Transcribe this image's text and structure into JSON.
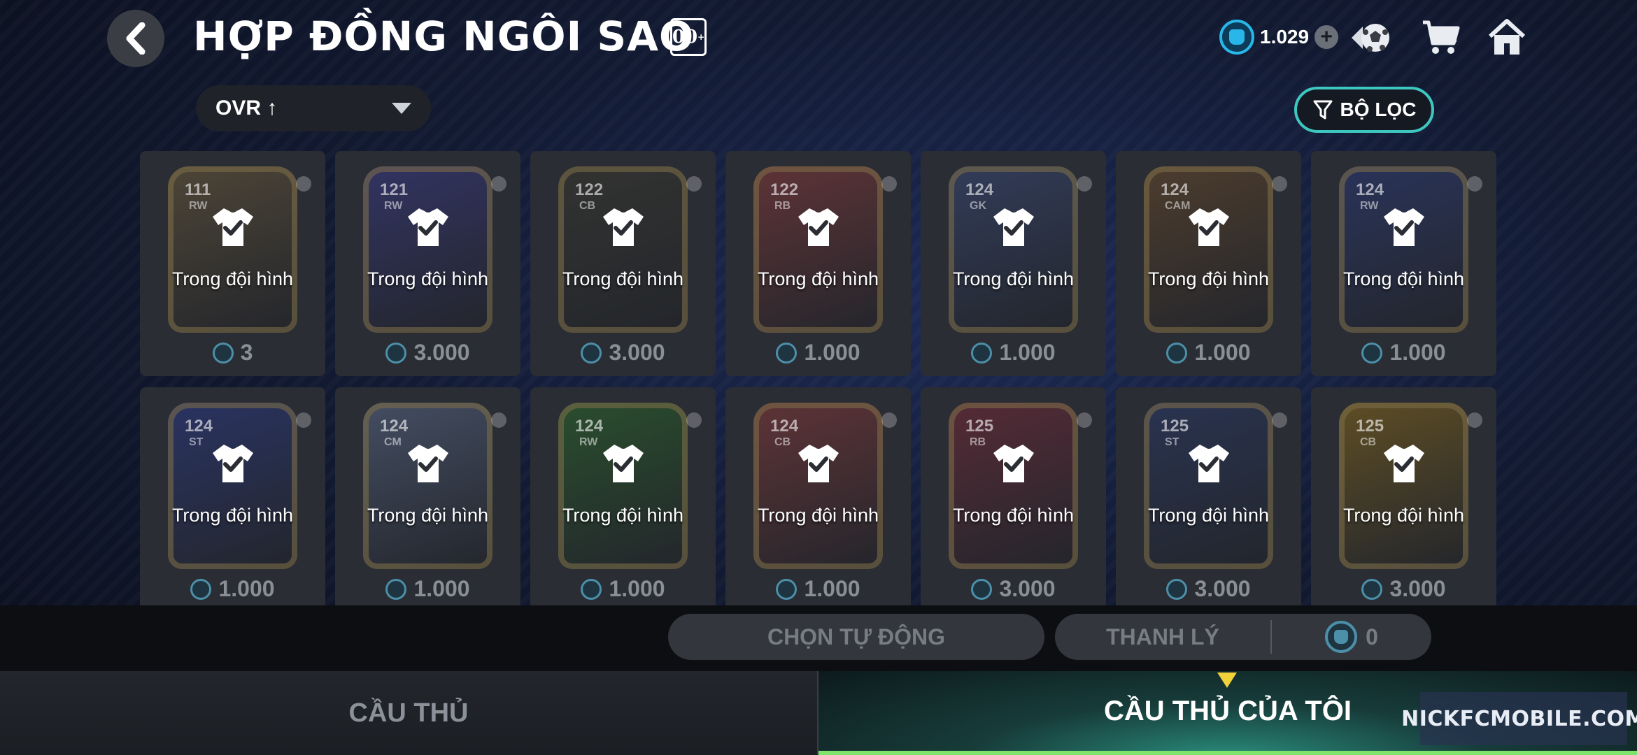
{
  "header": {
    "title": "HỢP ĐỒNG NGÔI SAO",
    "badge": "00",
    "currency_value": "1.029",
    "icons": [
      "back-icon",
      "coin-icon",
      "plus-icon",
      "ball-icon",
      "cart-icon",
      "home-icon"
    ]
  },
  "controls": {
    "sort_label": "OVR ↑",
    "filter_label": "BỘ LỌC"
  },
  "cards": [
    {
      "ovr": "111",
      "pos": "RW",
      "status": "Trong đội hình",
      "price": "3",
      "art": "#6b5a3a"
    },
    {
      "ovr": "121",
      "pos": "RW",
      "status": "Trong đội hình",
      "price": "3.000",
      "art": "#3a3a8a"
    },
    {
      "ovr": "122",
      "pos": "CB",
      "status": "Trong đội hình",
      "price": "3.000",
      "art": "#3a3a30"
    },
    {
      "ovr": "122",
      "pos": "RB",
      "status": "Trong đội hình",
      "price": "1.000",
      "art": "#8a3a3a"
    },
    {
      "ovr": "124",
      "pos": "GK",
      "status": "Trong đội hình",
      "price": "1.000",
      "art": "#3a4a7a"
    },
    {
      "ovr": "124",
      "pos": "CAM",
      "status": "Trong đội hình",
      "price": "1.000",
      "art": "#6a4a2a"
    },
    {
      "ovr": "124",
      "pos": "RW",
      "status": "Trong đội hình",
      "price": "1.000",
      "art": "#2a3a7a"
    },
    {
      "ovr": "124",
      "pos": "ST",
      "status": "Trong đội hình",
      "price": "1.000",
      "art": "#2a3a8a"
    },
    {
      "ovr": "124",
      "pos": "CM",
      "status": "Trong đội hình",
      "price": "1.000",
      "art": "#5a6a8a"
    },
    {
      "ovr": "124",
      "pos": "RW",
      "status": "Trong đội hình",
      "price": "1.000",
      "art": "#2a6a2a"
    },
    {
      "ovr": "124",
      "pos": "CB",
      "status": "Trong đội hình",
      "price": "1.000",
      "art": "#8a3a3a"
    },
    {
      "ovr": "125",
      "pos": "RB",
      "status": "Trong đội hình",
      "price": "3.000",
      "art": "#7a2a3a"
    },
    {
      "ovr": "125",
      "pos": "ST",
      "status": "Trong đội hình",
      "price": "3.000",
      "art": "#2a3a6a"
    },
    {
      "ovr": "125",
      "pos": "CB",
      "status": "Trong đội hình",
      "price": "3.000",
      "art": "#8a6a1a"
    }
  ],
  "actions": {
    "auto_select": "CHỌN TỰ ĐỘNG",
    "sell": "THANH LÝ",
    "sell_amount": "0"
  },
  "tabs": {
    "players": "CẦU THỦ",
    "my_players": "CẦU THỦ CỦA TÔI"
  },
  "watermark": "NICKFCMOBILE.COM"
}
